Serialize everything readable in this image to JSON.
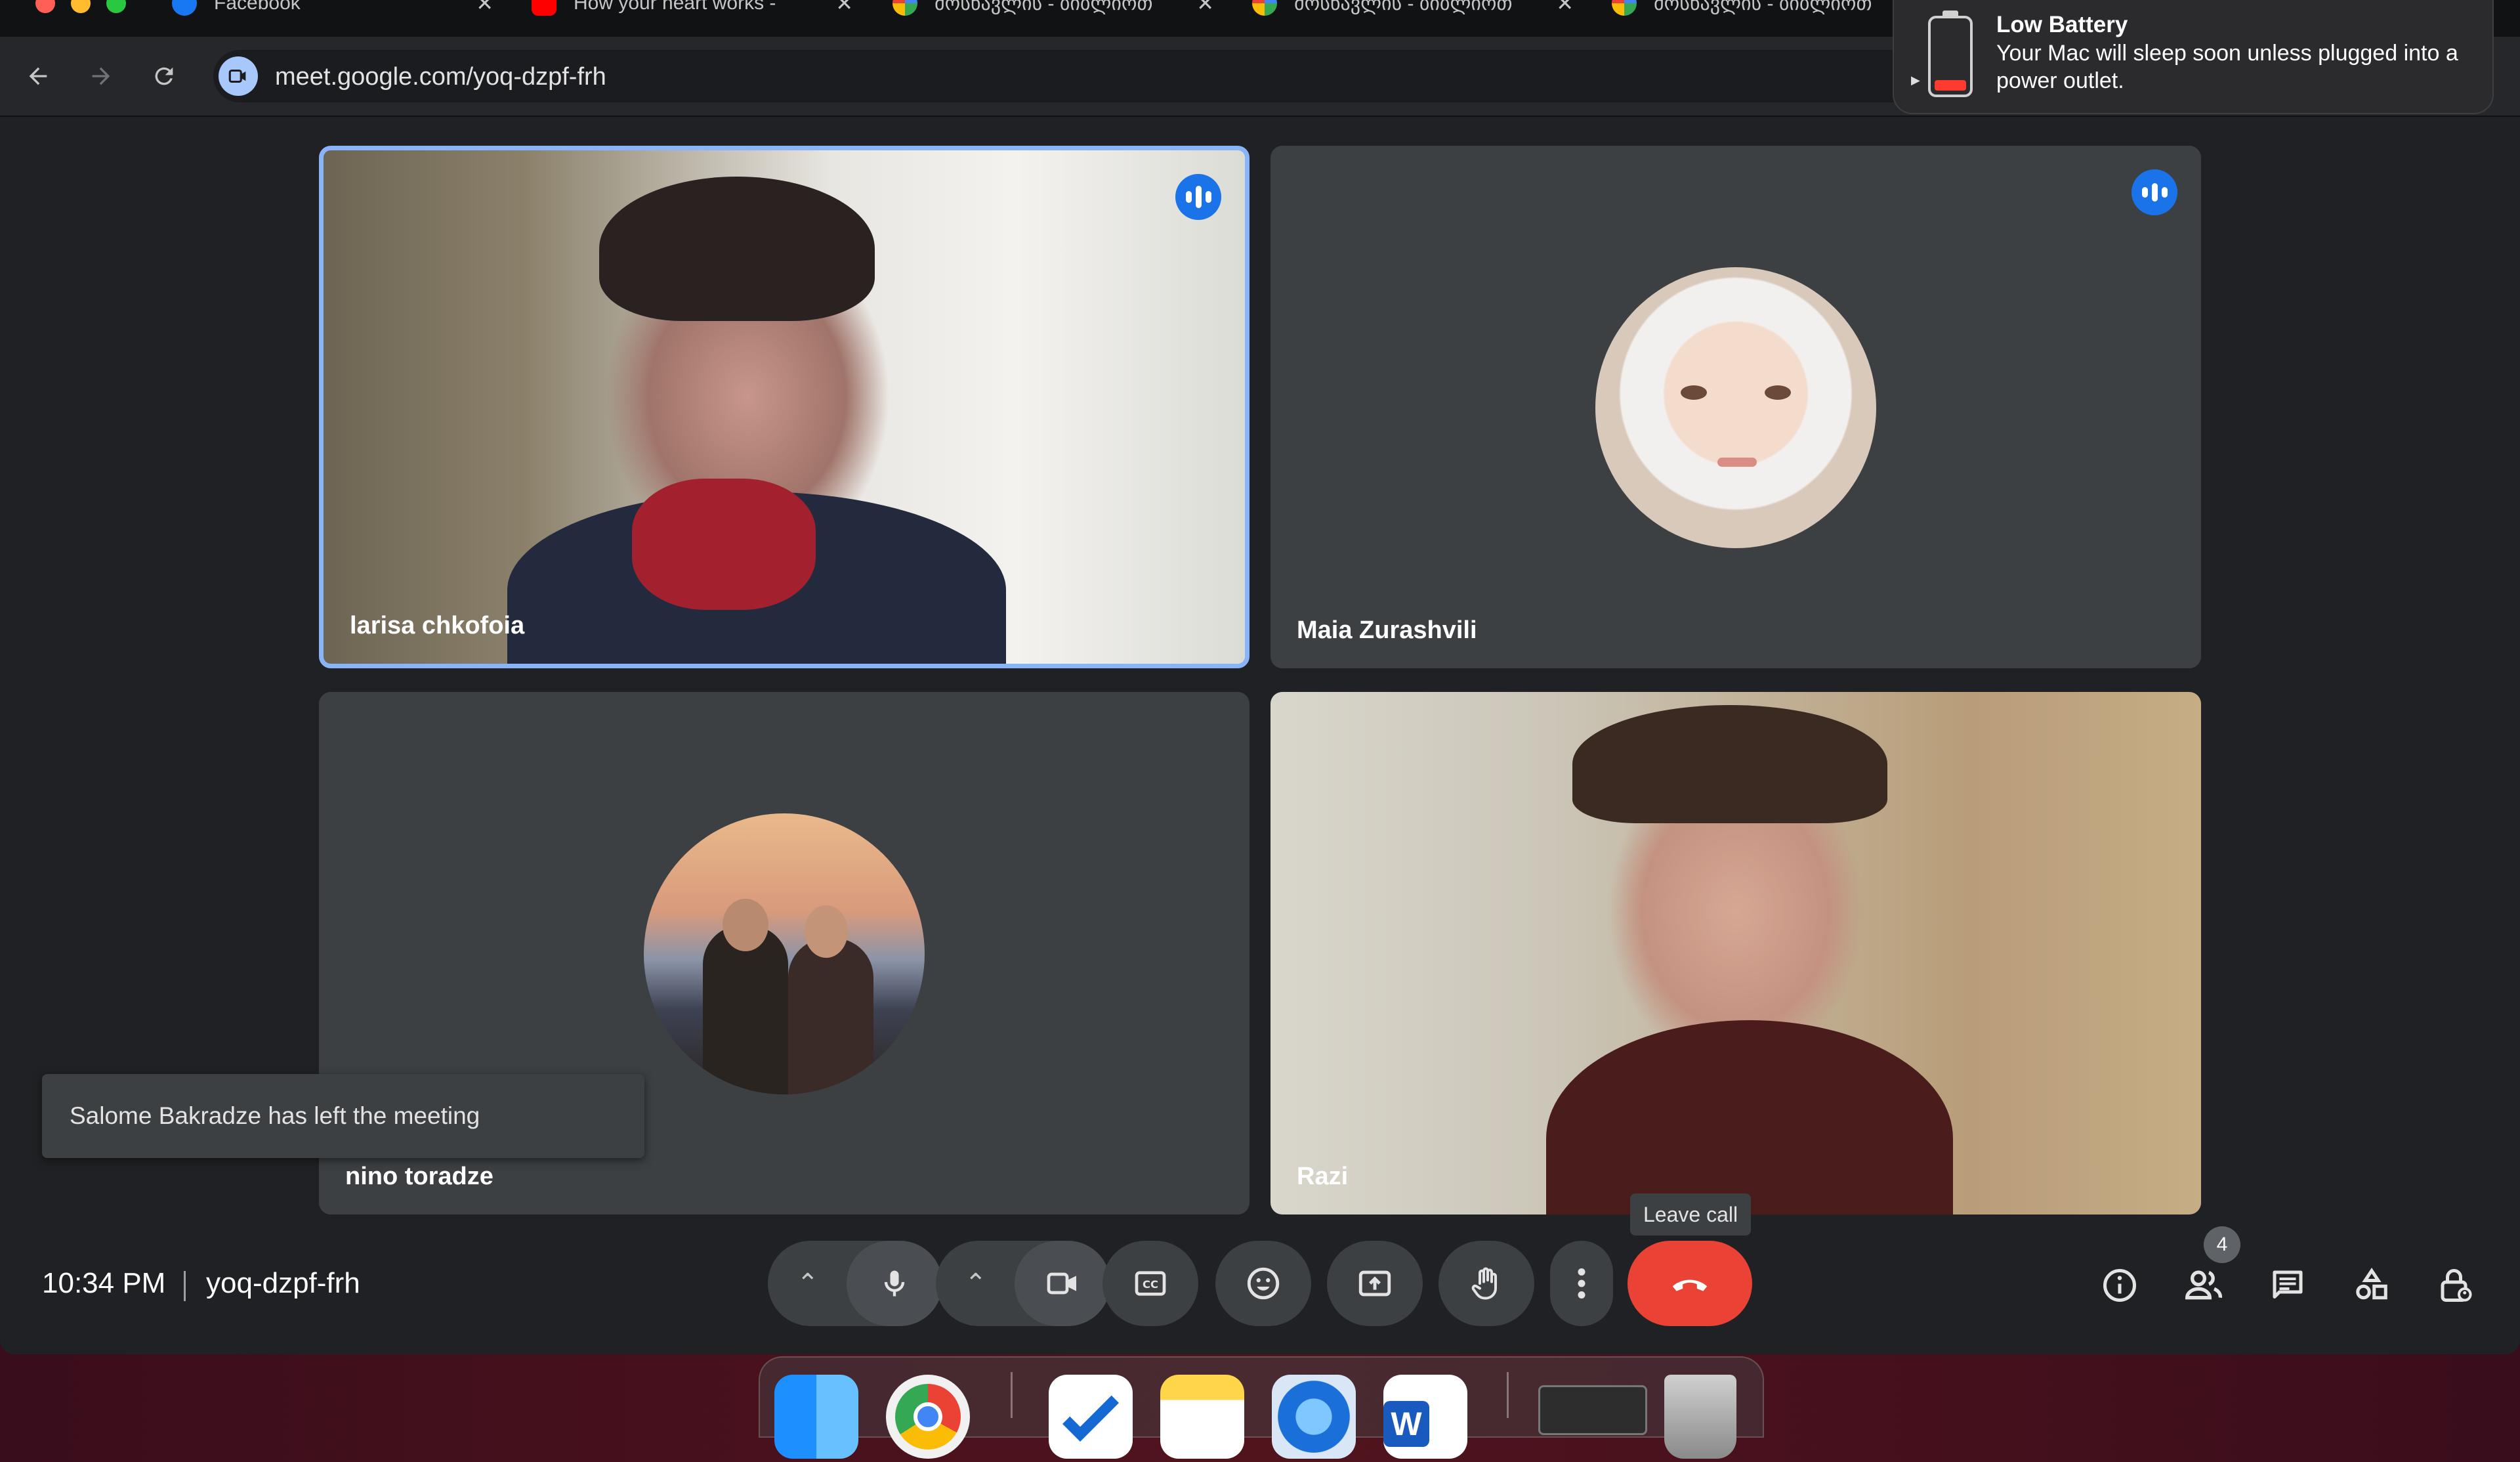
{
  "browser": {
    "tabs": [
      {
        "title": "Facebook"
      },
      {
        "title": "How your heart works -"
      },
      {
        "title": "მოსწავლის - ბიბლიოთ"
      },
      {
        "title": "მოსწავლის - ბიბლიოთ"
      },
      {
        "title": "მოსწავლის - ბიბლიოთ"
      }
    ],
    "url": "meet.google.com/yoq-dzpf-frh"
  },
  "notification": {
    "title": "Low Battery",
    "body": "Your Mac will sleep soon unless plugged into a power outlet."
  },
  "participants": [
    {
      "name": "larisa chkofoia",
      "speaking": true
    },
    {
      "name": "Maia Zurashvili",
      "speaking": true
    },
    {
      "name": "nino toradze",
      "speaking": false
    },
    {
      "name": "Razi",
      "speaking": false
    }
  ],
  "toast": {
    "text": "Salome Bakradze has left the meeting"
  },
  "meeting": {
    "time": "10:34 PM",
    "code": "yoq-dzpf-frh",
    "leave_tooltip": "Leave call",
    "participant_count": "4"
  }
}
